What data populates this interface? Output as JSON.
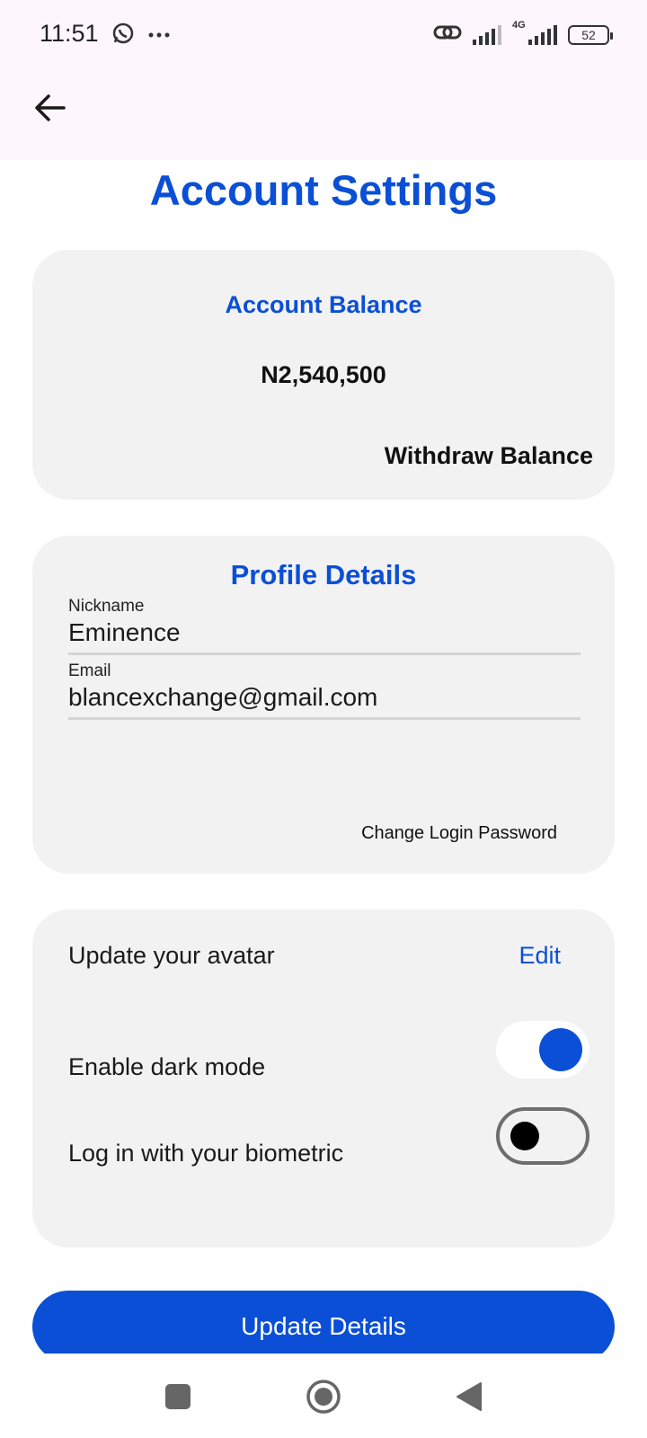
{
  "status_bar": {
    "time": "11:51",
    "left_icons": [
      "whatsapp-icon",
      "more-dots-icon"
    ],
    "right_icons": [
      "link-icon",
      "signal-icon",
      "4g-signal-icon",
      "battery-icon"
    ],
    "network_label": "4G",
    "battery_level": "52"
  },
  "app_bar": {
    "back_icon": "arrow-back-icon"
  },
  "page": {
    "title": "Account Settings"
  },
  "balance": {
    "title": "Account Balance",
    "amount": "N2,540,500",
    "withdraw_label": "Withdraw Balance"
  },
  "profile": {
    "title": "Profile Details",
    "nickname_label": "Nickname",
    "nickname_value": "Eminence",
    "email_label": "Email",
    "email_value": "blancexchange@gmail.com",
    "change_password_label": "Change Login Password"
  },
  "settings": {
    "avatar_label": "Update your avatar",
    "edit_label": "Edit",
    "dark_mode_label": "Enable dark mode",
    "dark_mode_enabled": true,
    "biometric_label": "Log in with your biometric",
    "biometric_enabled": false
  },
  "actions": {
    "update_label": "Update Details"
  },
  "nav_bar": {
    "icons": [
      "recent-apps-icon",
      "home-icon",
      "back-triangle-icon"
    ]
  },
  "colors": {
    "accent": "#0a4fd6",
    "card_bg": "#f2f2f2",
    "topbar_bg": "#fdf6fd"
  }
}
